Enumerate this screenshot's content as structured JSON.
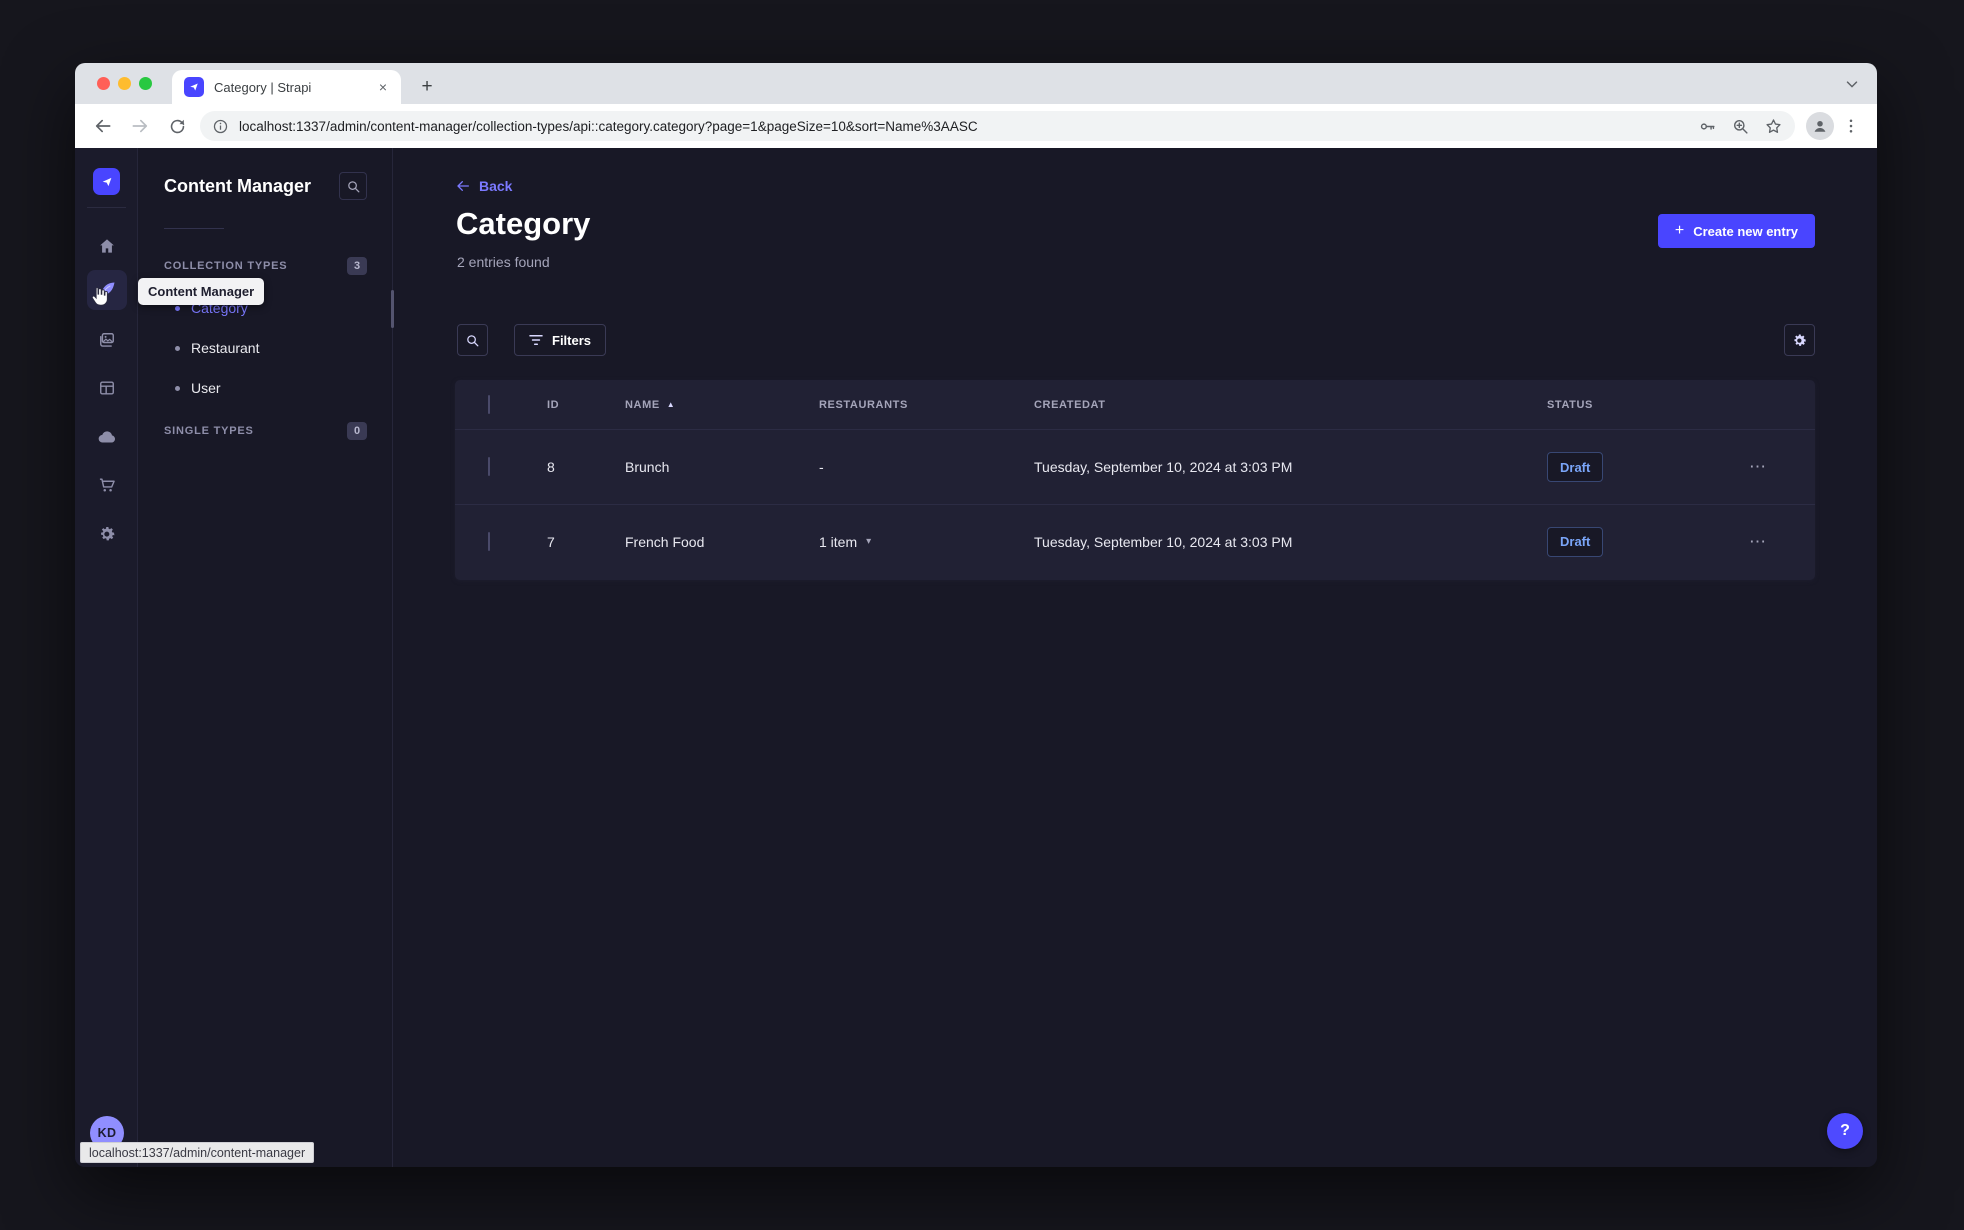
{
  "browser": {
    "tab_title": "Category | Strapi",
    "url": "localhost:1337/admin/content-manager/collection-types/api::category.category?page=1&pageSize=10&sort=Name%3AASC",
    "status_tooltip": "localhost:1337/admin/content-manager"
  },
  "rail": {
    "avatar_initials": "KD"
  },
  "nav": {
    "title": "Content Manager",
    "tooltip": "Content Manager",
    "collection_header": "COLLECTION TYPES",
    "collection_count": "3",
    "single_header": "SINGLE TYPES",
    "single_count": "0",
    "items": [
      {
        "label": "Category"
      },
      {
        "label": "Restaurant"
      },
      {
        "label": "User"
      }
    ]
  },
  "main": {
    "back_label": "Back",
    "title": "Category",
    "subtitle": "2 entries found",
    "create_button_label": "Create new entry",
    "filters_label": "Filters",
    "help_label": "?",
    "table": {
      "headers": {
        "id": "ID",
        "name": "NAME",
        "restaurants": "RESTAURANTS",
        "createdat": "CREATEDAT",
        "status": "STATUS"
      },
      "rows": [
        {
          "id": "8",
          "name": "Brunch",
          "restaurants": "-",
          "createdat": "Tuesday, September 10, 2024 at 3:03 PM",
          "status": "Draft"
        },
        {
          "id": "7",
          "name": "French Food",
          "restaurants": "1 item",
          "createdat": "Tuesday, September 10, 2024 at 3:03 PM",
          "status": "Draft"
        }
      ]
    }
  },
  "glyphs": {
    "plus": "+",
    "sort_asc": "▲",
    "caret_down": "▾",
    "dots": "⋯",
    "close": "×",
    "new_tab": "+"
  },
  "colors": {
    "primary": "#4945ff",
    "link": "#7b79ff",
    "draft_text": "#7aa5f8",
    "surface": "#212134",
    "background": "#181826"
  }
}
